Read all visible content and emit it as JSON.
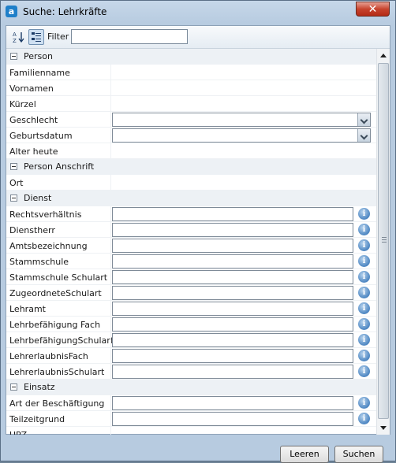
{
  "window": {
    "title": "Suche: Lehrkräfte",
    "close_label": "✕",
    "app_icon_letter": "a"
  },
  "toolbar": {
    "filter_label": "Filter",
    "filter_value": "",
    "sort_icon": "sort-alphabetical-icon",
    "category_icon": "categorized-view-icon"
  },
  "grid": {
    "rows": [
      {
        "kind": "category",
        "label": "Person"
      },
      {
        "kind": "property",
        "label": "Familienname",
        "editor": "none"
      },
      {
        "kind": "property",
        "label": "Vornamen",
        "editor": "none"
      },
      {
        "kind": "property",
        "label": "Kürzel",
        "editor": "none"
      },
      {
        "kind": "property",
        "label": "Geschlecht",
        "editor": "dropdown"
      },
      {
        "kind": "property",
        "label": "Geburtsdatum",
        "editor": "dropdown"
      },
      {
        "kind": "property",
        "label": "Alter heute",
        "editor": "none"
      },
      {
        "kind": "category",
        "label": "Person Anschrift"
      },
      {
        "kind": "property",
        "label": "Ort",
        "editor": "none"
      },
      {
        "kind": "category",
        "label": "Dienst"
      },
      {
        "kind": "property",
        "label": "Rechtsverhältnis",
        "editor": "text-info"
      },
      {
        "kind": "property",
        "label": "Dienstherr",
        "editor": "text-info"
      },
      {
        "kind": "property",
        "label": "Amtsbezeichnung",
        "editor": "text-info"
      },
      {
        "kind": "property",
        "label": "Stammschule",
        "editor": "text-info"
      },
      {
        "kind": "property",
        "label": "Stammschule Schulart",
        "editor": "text-info"
      },
      {
        "kind": "property",
        "label": "ZugeordneteSchulart",
        "editor": "text-info"
      },
      {
        "kind": "property",
        "label": "Lehramt",
        "editor": "text-info"
      },
      {
        "kind": "property",
        "label": "Lehrbefähigung Fach",
        "editor": "text-info"
      },
      {
        "kind": "property",
        "label": "LehrbefähigungSchulart",
        "editor": "text-info"
      },
      {
        "kind": "property",
        "label": "LehrerlaubnisFach",
        "editor": "text-info"
      },
      {
        "kind": "property",
        "label": "LehrerlaubnisSchulart",
        "editor": "text-info"
      },
      {
        "kind": "category",
        "label": "Einsatz"
      },
      {
        "kind": "property",
        "label": "Art der Beschäftigung",
        "editor": "text-info"
      },
      {
        "kind": "property",
        "label": "Teilzeitgrund",
        "editor": "text-info"
      },
      {
        "kind": "property",
        "label": "UPZ",
        "editor": "none"
      }
    ]
  },
  "footer": {
    "clear_label": "Leeren",
    "search_label": "Suchen"
  },
  "colors": {
    "accent": "#1e7fc9",
    "close_red": "#c7442e",
    "info_blue": "#4d86c2"
  }
}
